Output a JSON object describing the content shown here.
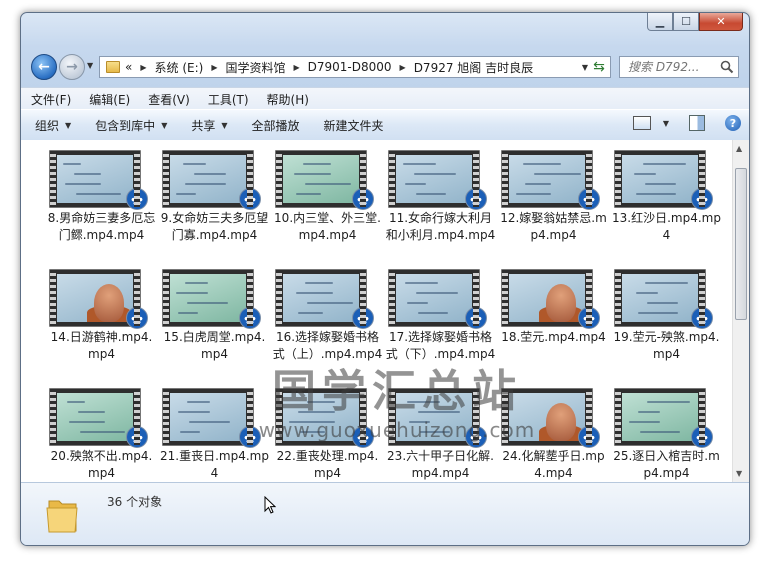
{
  "address": {
    "overflow": "«",
    "crumbs": [
      "系统 (E:)",
      "国学资料馆",
      "D7901-D8000",
      "D7927 旭阁 吉时良辰"
    ]
  },
  "search": {
    "placeholder": "搜索 D792..."
  },
  "menu": [
    "文件(F)",
    "编辑(E)",
    "查看(V)",
    "工具(T)",
    "帮助(H)"
  ],
  "commands": [
    "组织",
    "包含到库中",
    "共享",
    "全部播放",
    "新建文件夹"
  ],
  "files": [
    {
      "name": "8.男命妨三妻多厄忘门鳏.mp4.mp4",
      "type": "board"
    },
    {
      "name": "9.女命妨三夫多厄望门寡.mp4.mp4",
      "type": "board"
    },
    {
      "name": "10.内三堂、外三堂.mp4.mp4",
      "type": "board"
    },
    {
      "name": "11.女命行嫁大利月和小利月.mp4.mp4",
      "type": "board"
    },
    {
      "name": "12.嫁娶翁姑禁忌.mp4.mp4",
      "type": "board"
    },
    {
      "name": "13.红沙日.mp4.mp4",
      "type": "board"
    },
    {
      "name": "14.日游鹤神.mp4.mp4",
      "type": "monk"
    },
    {
      "name": "15.白虎周堂.mp4.mp4",
      "type": "board"
    },
    {
      "name": "16.选择嫁娶婚书格式（上）.mp4.mp4",
      "type": "board"
    },
    {
      "name": "17.选择嫁娶婚书格式（下）.mp4.mp4",
      "type": "board"
    },
    {
      "name": "18.茔元.mp4.mp4",
      "type": "monk"
    },
    {
      "name": "19.茔元-殃煞.mp4.mp4",
      "type": "board"
    },
    {
      "name": "20.殃煞不出.mp4.mp4",
      "type": "board"
    },
    {
      "name": "21.重丧日.mp4.mp4",
      "type": "board"
    },
    {
      "name": "22.重丧处理.mp4.mp4",
      "type": "board"
    },
    {
      "name": "23.六十甲子日化解.mp4.mp4",
      "type": "board"
    },
    {
      "name": "24.化解塟乎日.mp4.mp4",
      "type": "monk"
    },
    {
      "name": "25.逐日入棺吉时.mp4.mp4",
      "type": "board"
    }
  ],
  "watermark": {
    "cn": "国学汇总站",
    "url": "www.guoxuehuizong.com"
  },
  "status": {
    "count": "36 个对象"
  },
  "colors": {
    "accent": "#1b5fb7",
    "close": "#c74a32"
  }
}
